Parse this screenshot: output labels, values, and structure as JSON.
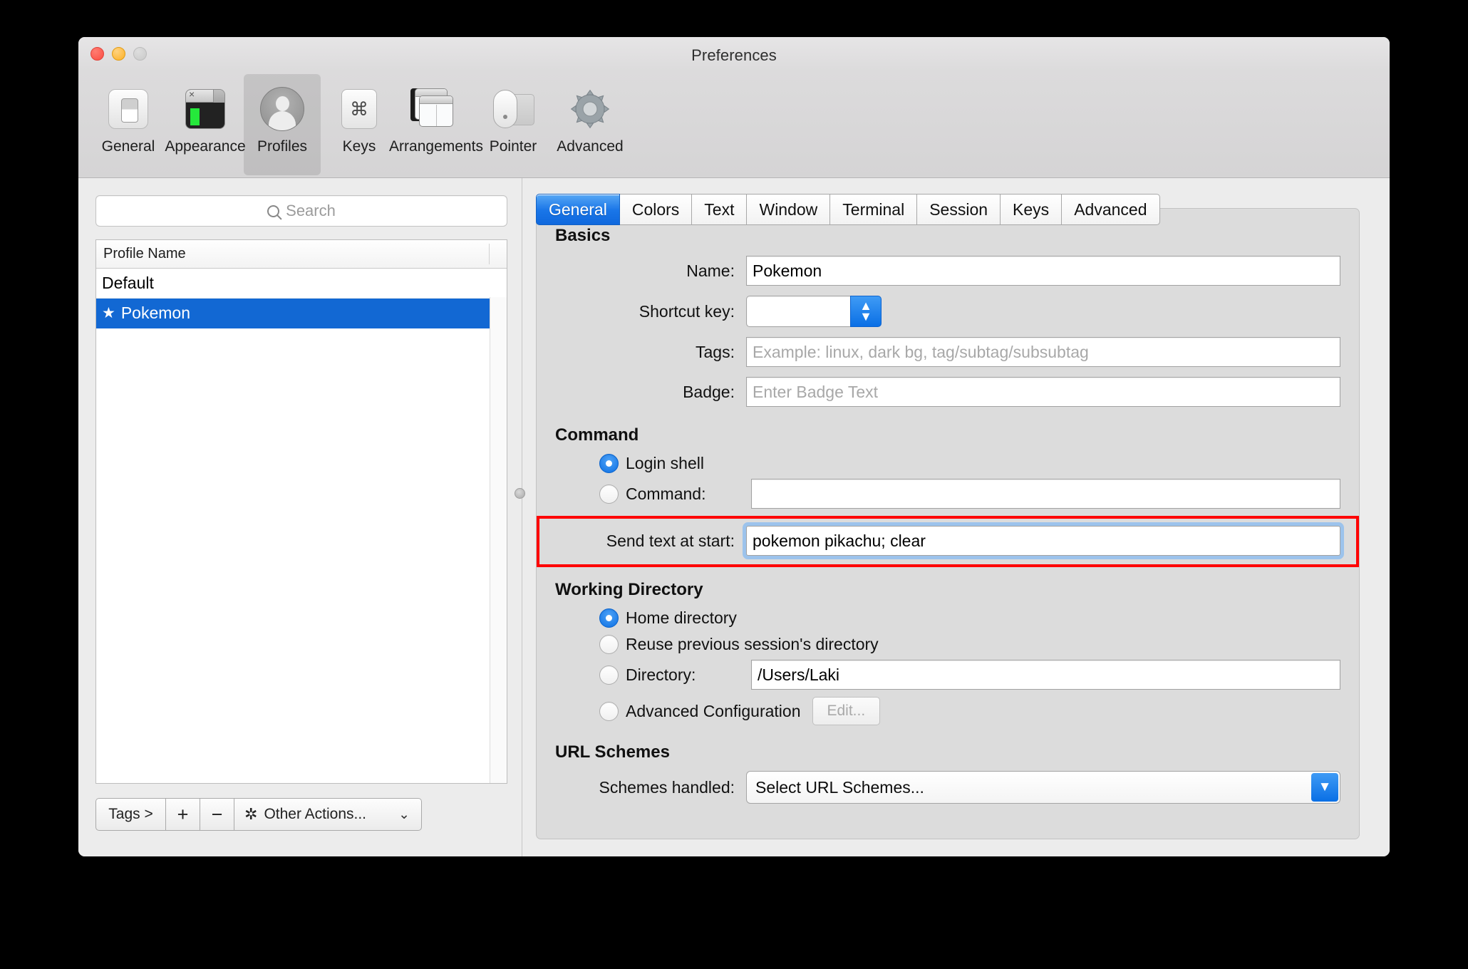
{
  "window": {
    "title": "Preferences",
    "traffic_lights": [
      "close",
      "minimize",
      "zoom"
    ]
  },
  "toolbar": {
    "items": [
      {
        "label": "General",
        "icon": "display-toggle-icon",
        "selected": false
      },
      {
        "label": "Appearance",
        "icon": "terminal-window-icon",
        "selected": false
      },
      {
        "label": "Profiles",
        "icon": "person-silhouette-icon",
        "selected": true
      },
      {
        "label": "Keys",
        "icon": "command-key-icon",
        "selected": false
      },
      {
        "label": "Arrangements",
        "icon": "windows-stack-icon",
        "selected": false
      },
      {
        "label": "Pointer",
        "icon": "mouse-icon",
        "selected": false
      },
      {
        "label": "Advanced",
        "icon": "gear-icon",
        "selected": false
      }
    ]
  },
  "sidebar": {
    "search": {
      "placeholder": "Search",
      "value": "",
      "icon": "search-icon"
    },
    "list": {
      "column_header": "Profile Name",
      "rows": [
        {
          "name": "Default",
          "starred": false,
          "selected": false
        },
        {
          "name": "Pokemon",
          "starred": true,
          "selected": true,
          "star_glyph": "★"
        }
      ]
    },
    "bottom_bar": {
      "tags_label": "Tags >",
      "add_label": "+",
      "remove_label": "−",
      "other_actions_label": "Other Actions...",
      "other_actions_icon": "gear-icon",
      "caret_glyph": "⌄"
    }
  },
  "tabs": [
    {
      "label": "General",
      "active": true
    },
    {
      "label": "Colors",
      "active": false
    },
    {
      "label": "Text",
      "active": false
    },
    {
      "label": "Window",
      "active": false
    },
    {
      "label": "Terminal",
      "active": false
    },
    {
      "label": "Session",
      "active": false
    },
    {
      "label": "Keys",
      "active": false
    },
    {
      "label": "Advanced",
      "active": false
    }
  ],
  "general_tab": {
    "basics": {
      "heading": "Basics",
      "name_label": "Name:",
      "name_value": "Pokemon",
      "shortcut_label": "Shortcut key:",
      "shortcut_value": "",
      "stepper_up": "⌃",
      "stepper_down": "⌄",
      "tags_label": "Tags:",
      "tags_value": "",
      "tags_placeholder": "Example: linux, dark bg, tag/subtag/subsubtag",
      "badge_label": "Badge:",
      "badge_value": "",
      "badge_placeholder": "Enter Badge Text"
    },
    "command": {
      "heading": "Command",
      "login_shell_label": "Login shell",
      "login_shell_selected": true,
      "command_label": "Command:",
      "command_selected": false,
      "command_value": "",
      "send_text_label": "Send text at start:",
      "send_text_value": "pokemon pikachu; clear",
      "send_text_focused": true,
      "annotation": {
        "type": "red-highlight-box",
        "color": "#ff0000"
      }
    },
    "working_directory": {
      "heading": "Working Directory",
      "options": [
        {
          "label": "Home directory",
          "selected": true
        },
        {
          "label": "Reuse previous session's directory",
          "selected": false
        },
        {
          "label": "Directory:",
          "selected": false,
          "value": "/Users/Laki"
        },
        {
          "label": "Advanced Configuration",
          "selected": false,
          "button": "Edit..."
        }
      ]
    },
    "url_schemes": {
      "heading": "URL Schemes",
      "schemes_label": "Schemes handled:",
      "schemes_value": "Select URL Schemes...",
      "caret_glyph": "⌄"
    }
  },
  "colors": {
    "accent_blue": "#1268d3",
    "tab_active_blue": "#1a76e8",
    "annotation_red": "#ff0000",
    "focus_ring": "#9cc3ec",
    "window_bg": "#ececec",
    "panel_bg": "#dcdcdc"
  }
}
